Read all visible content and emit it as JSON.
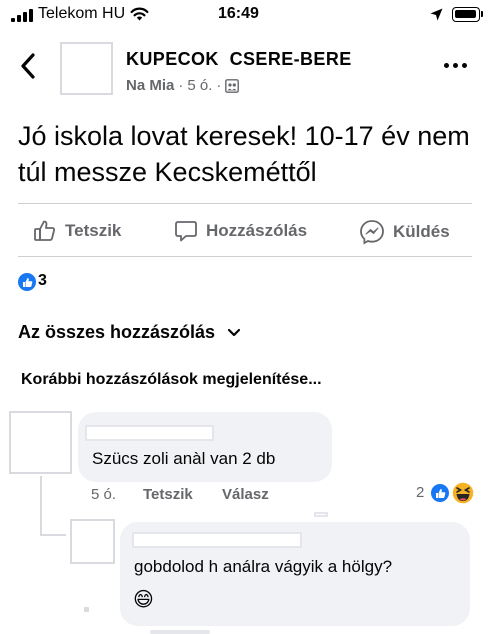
{
  "status_bar": {
    "carrier": "Telekom HU",
    "time": "16:49"
  },
  "header": {
    "group_name": "KUPECOK  CSERE-BERE",
    "author": "Na Mia",
    "time": "5 ó.",
    "separator": "·",
    "audience_icon": "group-audience-icon"
  },
  "post": {
    "text": "Jó iskola lovat keresek!  10-17 év nem túl messze Kecskeméttől"
  },
  "actions": {
    "like": "Tetszik",
    "comment": "Hozzászólás",
    "send": "Küldés"
  },
  "reactions": {
    "count": "3"
  },
  "comments_section": {
    "sort_label": "Az összes hozzászólás",
    "show_previous": "Korábbi hozzászólások megjelenítése..."
  },
  "comments": [
    {
      "text": "Szücs zoli anàl van 2 db",
      "time": "5 ó.",
      "like": "Tetszik",
      "reply": "Válasz",
      "reaction_count": "2"
    },
    {
      "text": "gobdolod h análra vágyik a hölgy?",
      "emoji": "😄"
    }
  ],
  "colors": {
    "accent": "#1877f2",
    "secondary_text": "#65676b",
    "bubble": "#f0f2f5"
  }
}
